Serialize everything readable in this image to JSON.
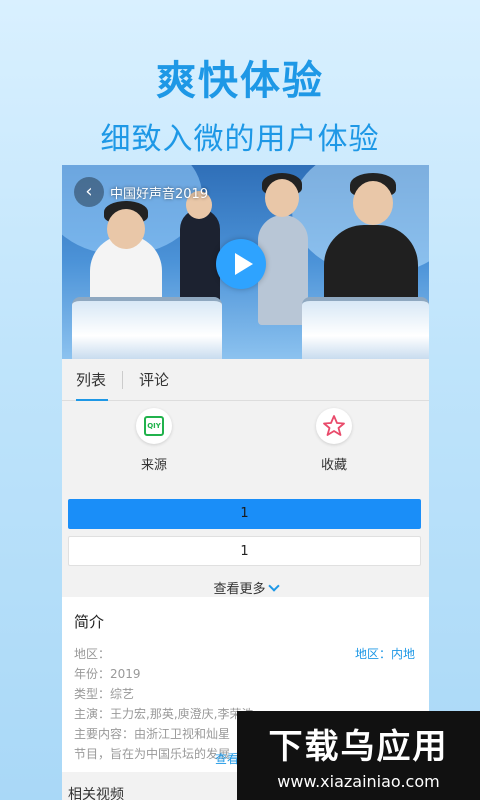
{
  "promo": {
    "headline": "爽快体验",
    "subheadline": "细致入微的用户体验"
  },
  "player": {
    "title": "中国好声音2019",
    "back_icon": "back-arrow-icon",
    "play_icon": "play-icon"
  },
  "tabs": [
    {
      "label": "列表",
      "active": true
    },
    {
      "label": "评论",
      "active": false
    }
  ],
  "actions": [
    {
      "label": "来源",
      "icon": "iqiyi-logo-icon",
      "icon_text": "QIY"
    },
    {
      "label": "收藏",
      "icon": "star-icon"
    }
  ],
  "episodes": [
    {
      "label": "1",
      "active": true
    },
    {
      "label": "1",
      "active": false
    }
  ],
  "more_label": "查看更多",
  "intro": {
    "title": "简介",
    "region_label": "地区：",
    "region_link": "地区：内地",
    "year": "年份：2019",
    "genre": "类型：综艺",
    "cast": "主演：王力宏,那英,庾澄庆,李荣浩",
    "summary_line1": "主要内容：由浙江卫视和灿星",
    "summary_line2": "节目，旨在为中国乐坛的发展",
    "more_label": "查看"
  },
  "related": {
    "title": "相关视频"
  },
  "watermark": {
    "brand": "下载乌应用",
    "url": "www.xiazainiao.com"
  },
  "colors": {
    "accent": "#1e98e6",
    "episode_active": "#1a8ef8",
    "iqiyi_green": "#21b24c",
    "star_pink": "#e94b6b"
  }
}
